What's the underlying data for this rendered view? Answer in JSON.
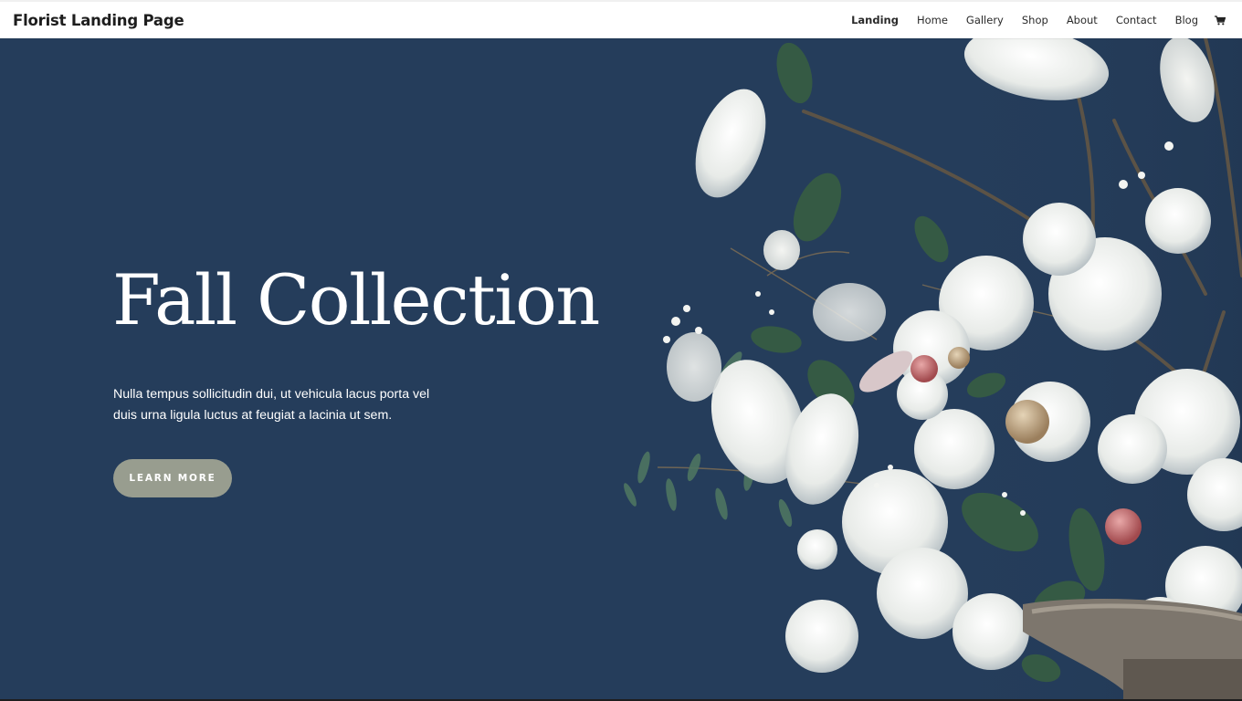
{
  "header": {
    "site_title": "Florist Landing Page",
    "nav": [
      {
        "label": "Landing",
        "active": true
      },
      {
        "label": "Home"
      },
      {
        "label": "Gallery"
      },
      {
        "label": "Shop"
      },
      {
        "label": "About"
      },
      {
        "label": "Contact"
      },
      {
        "label": "Blog"
      }
    ],
    "cart_icon": "shopping-cart-icon"
  },
  "hero": {
    "title": "Fall Collection",
    "description": "Nulla tempus sollicitudin dui, ut vehicula lacus porta vel duis urna ligula luctus at feugiat a lacinia ut sem.",
    "button_label": "LEARN MORE",
    "background_color": "#253d5b",
    "button_color": "#989d8f",
    "image": "white-flower-bouquet"
  }
}
